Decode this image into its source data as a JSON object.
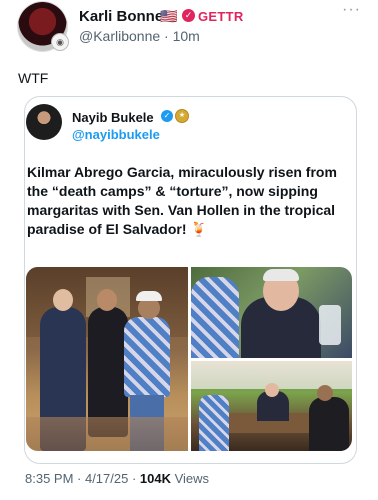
{
  "post": {
    "author_name": "Karli Bonne'",
    "flag": "🇺🇸",
    "platform": "GETTR",
    "handle": "@Karlibonne",
    "time": "10m",
    "more": "···",
    "text": "WTF"
  },
  "quote": {
    "author_name": "Nayib Bukele",
    "handle": "@nayibbukele",
    "text": "Kilmar Abrego Garcia, miraculously risen from the “death camps” & “torture”, now sipping margaritas with Sen. Van Hollen in the tropical paradise of El Salvador! 🍹",
    "photos": [
      "handshake-photo",
      "table-closeup-photo",
      "restaurant-photo"
    ]
  },
  "footer": {
    "time": "8:35 PM · 4/17/25 · ",
    "views_count": "104K",
    "views_label": " Views"
  },
  "colors": {
    "accent": "#1d9bf0",
    "gettr": "#e0245e",
    "muted": "#536471"
  },
  "icons": [
    "avatar",
    "us-flag-icon",
    "verified-red-icon",
    "more-icon",
    "verified-blue-icon",
    "gold-seal-icon",
    "cocktail-icon"
  ]
}
